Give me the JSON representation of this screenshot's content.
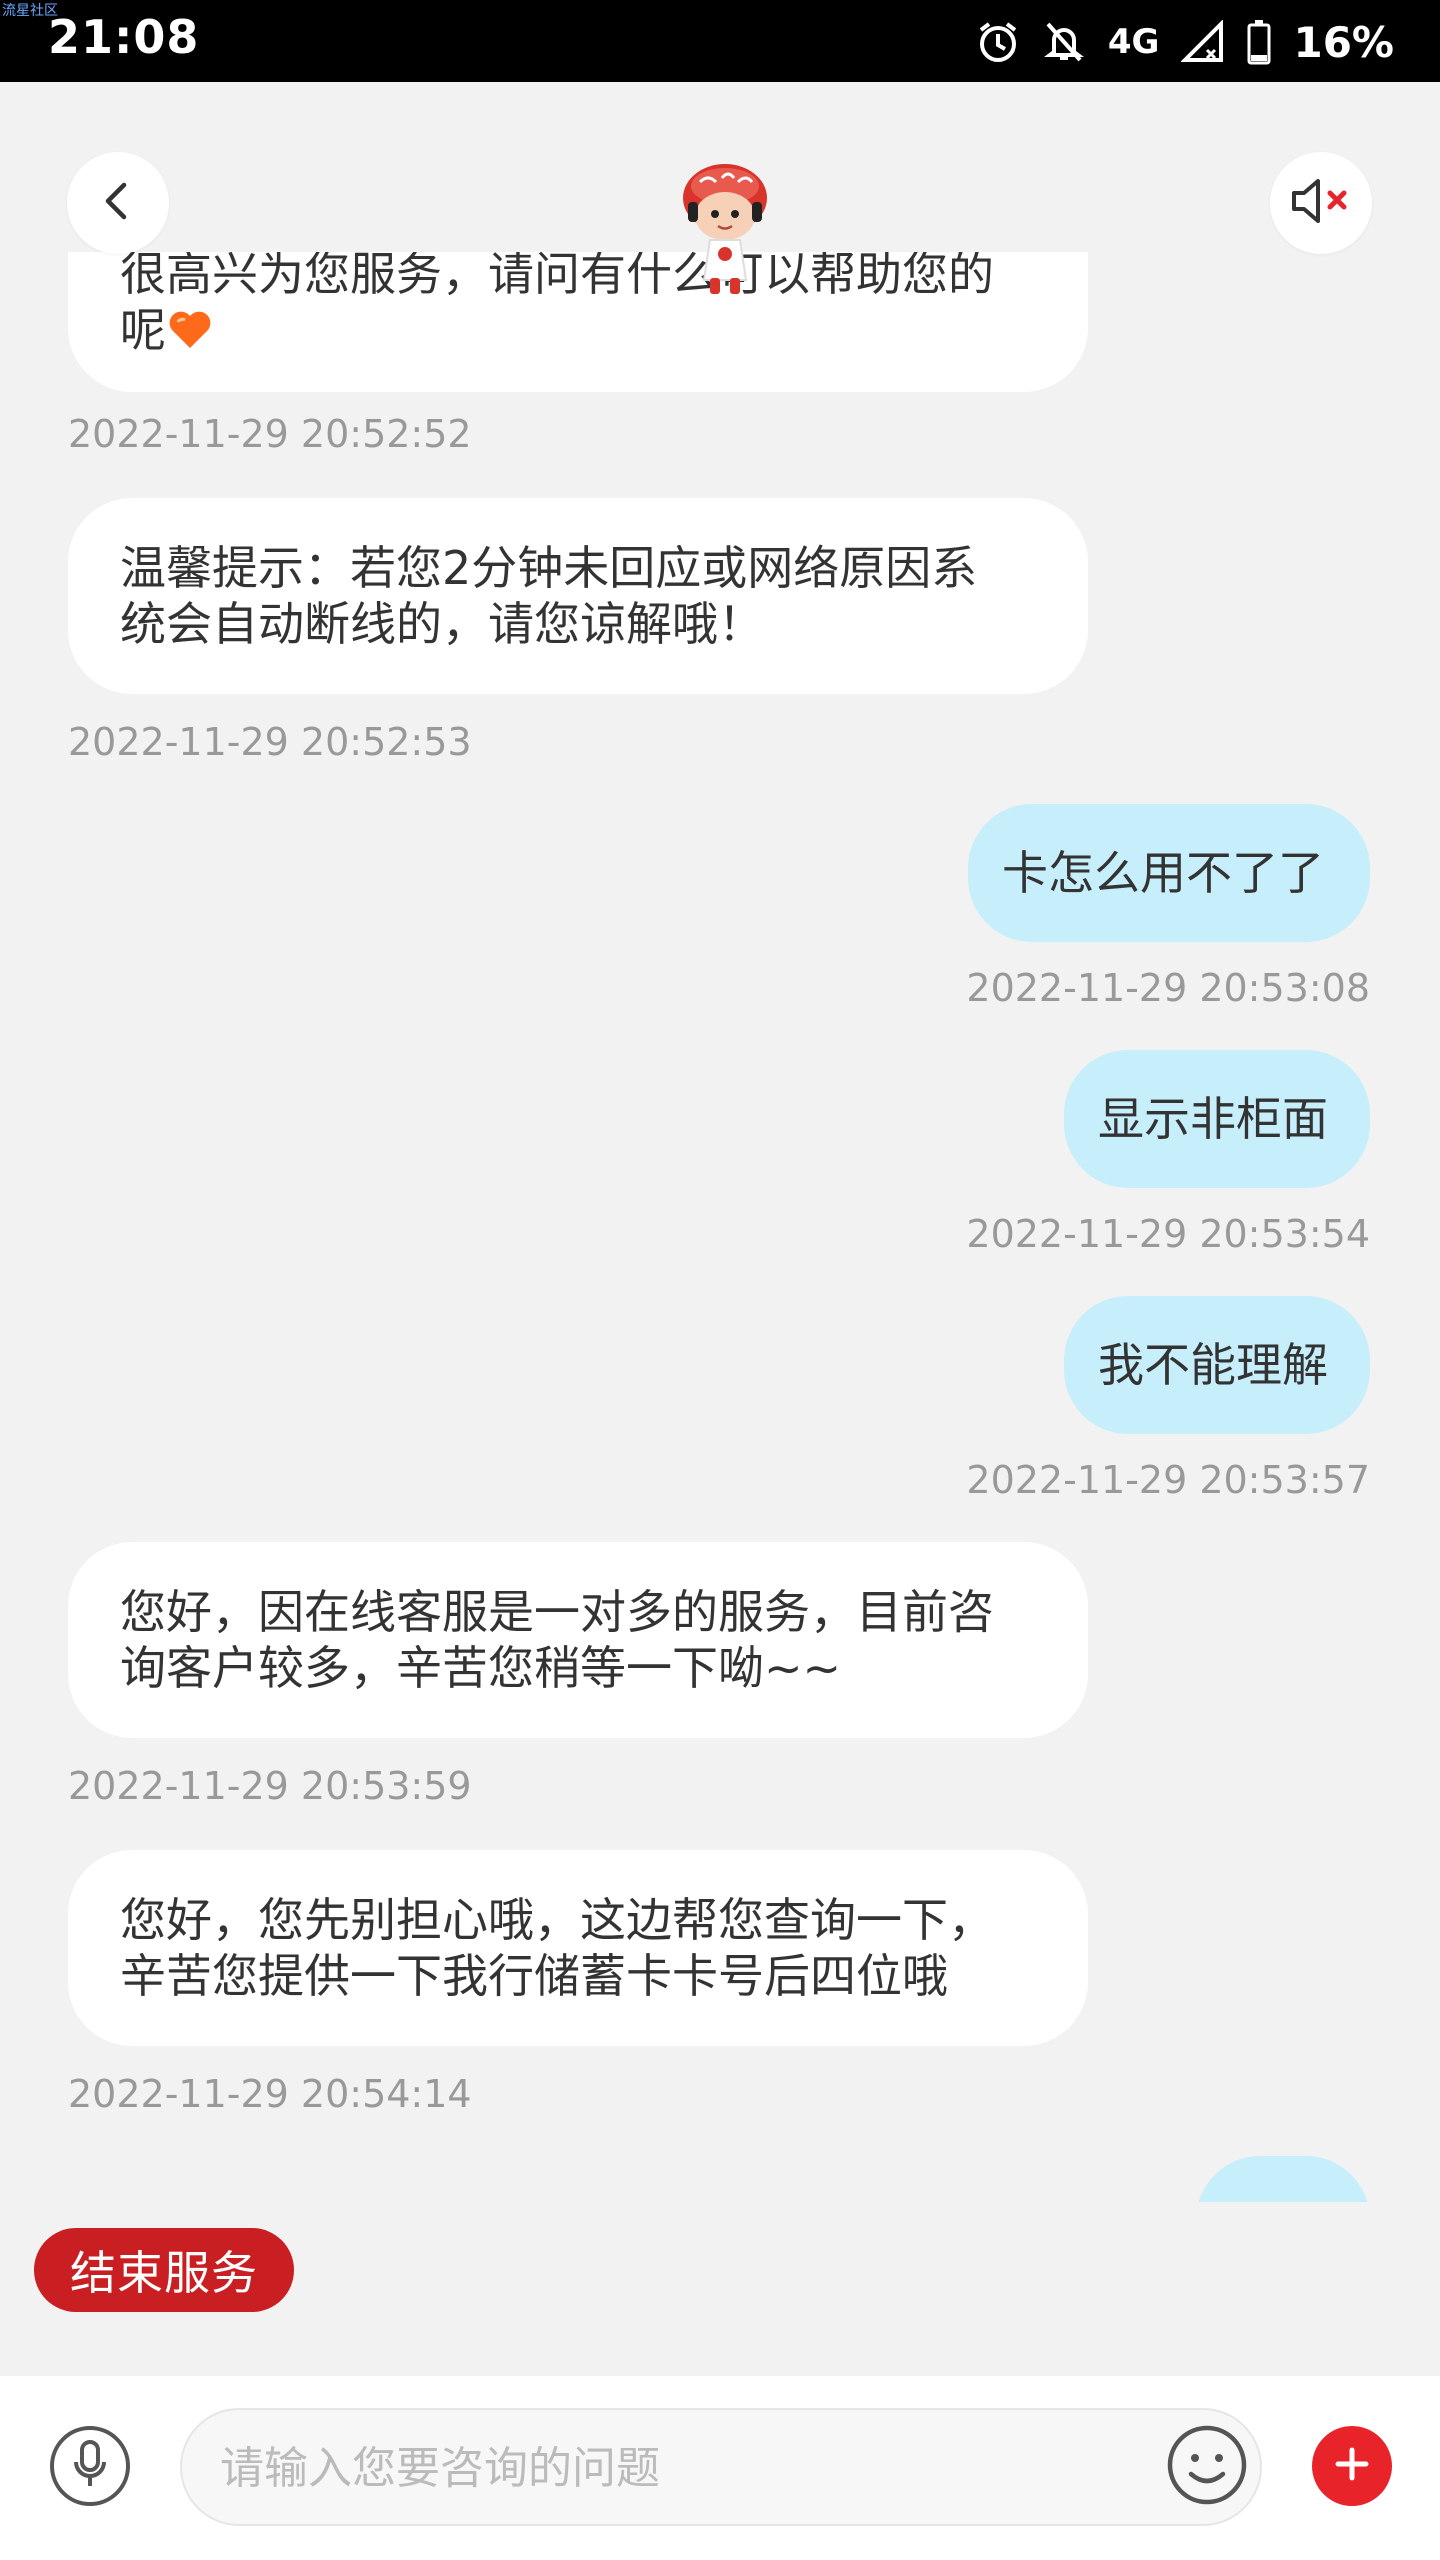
{
  "status_bar": {
    "watermark": "流星社区",
    "time": "21:08",
    "network": "4G",
    "battery": "16%"
  },
  "header": {
    "back_icon": "chevron-left-icon",
    "mute_icon": "speaker-muted-icon"
  },
  "messages": [
    {
      "side": "left",
      "lines": [
        "很高兴为您服务，请问有什么可以帮助您的",
        "呢"
      ],
      "has_heart": true,
      "time": "2022-11-29 20:52:52"
    },
    {
      "side": "left",
      "lines": [
        "温馨提示：若您2分钟未回应或网络原因系",
        "统会自动断线的，请您谅解哦！"
      ],
      "time": "2022-11-29 20:52:53"
    },
    {
      "side": "right",
      "lines": [
        "卡怎么用不了了"
      ],
      "time": "2022-11-29 20:53:08"
    },
    {
      "side": "right",
      "lines": [
        "显示非柜面"
      ],
      "time": "2022-11-29 20:53:54"
    },
    {
      "side": "right",
      "lines": [
        "我不能理解"
      ],
      "time": "2022-11-29 20:53:57"
    },
    {
      "side": "left",
      "lines": [
        "您好，因在线客服是一对多的服务，目前咨",
        "询客户较多，辛苦您稍等一下呦~~"
      ],
      "time": "2022-11-29 20:53:59"
    },
    {
      "side": "left",
      "lines": [
        "您好，您先别担心哦，这边帮您查询一下，",
        "辛苦您提供一下我行储蓄卡卡号后四位哦"
      ],
      "time": "2022-11-29 20:54:14"
    }
  ],
  "end_service_label": "结束服务",
  "input": {
    "placeholder": "请输入您要咨询的问题"
  },
  "colors": {
    "user_bubble": "#c7eefb",
    "agent_bubble": "#ffffff",
    "accent_red": "#c91e22"
  }
}
